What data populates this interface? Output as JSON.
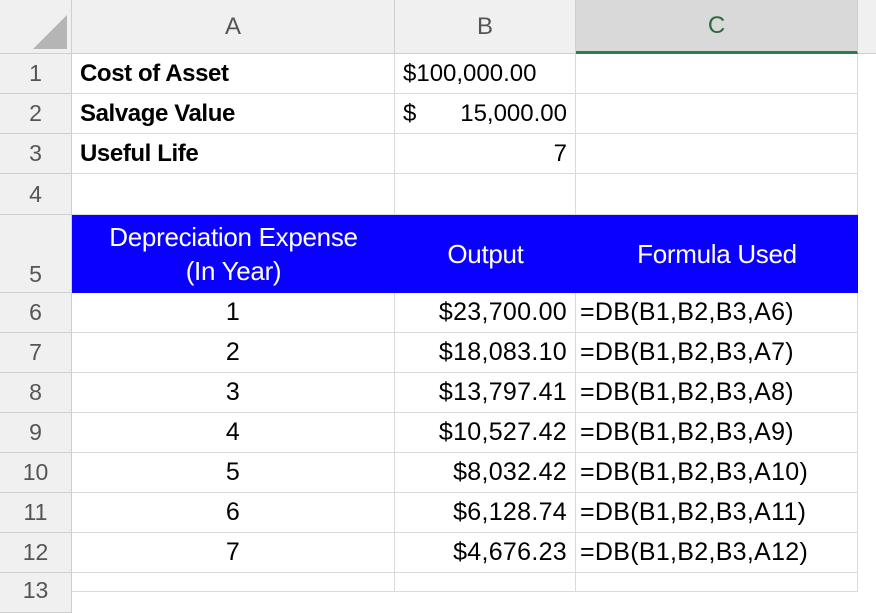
{
  "columns": [
    "A",
    "B",
    "C"
  ],
  "rows": [
    "1",
    "2",
    "3",
    "4",
    "5",
    "6",
    "7",
    "8",
    "9",
    "10",
    "11",
    "12",
    "13"
  ],
  "inputs": [
    {
      "label": "Cost of Asset",
      "value": "$100,000.00"
    },
    {
      "label": "Salvage Value",
      "currency": "$",
      "value": "15,000.00"
    },
    {
      "label": "Useful Life",
      "value": "7"
    }
  ],
  "table_header": {
    "col_a_line1": "Depreciation Expense",
    "col_a_line2": "(In Year)",
    "col_b": "Output",
    "col_c": "Formula Used"
  },
  "table_rows": [
    {
      "year": "1",
      "output": "$23,700.00",
      "formula": "=DB(B1,B2,B3,A6)"
    },
    {
      "year": "2",
      "output": "$18,083.10",
      "formula": "=DB(B1,B2,B3,A7)"
    },
    {
      "year": "3",
      "output": "$13,797.41",
      "formula": "=DB(B1,B2,B3,A8)"
    },
    {
      "year": "4",
      "output": "$10,527.42",
      "formula": "=DB(B1,B2,B3,A9)"
    },
    {
      "year": "5",
      "output": "$8,032.42",
      "formula": "=DB(B1,B2,B3,A10)"
    },
    {
      "year": "6",
      "output": "$6,128.74",
      "formula": "=DB(B1,B2,B3,A11)"
    },
    {
      "year": "7",
      "output": "$4,676.23",
      "formula": "=DB(B1,B2,B3,A12)"
    }
  ],
  "colors": {
    "header_fill": "#0a00ff",
    "header_text": "#ffffff",
    "selected_column_accent": "#2e7d4f"
  }
}
